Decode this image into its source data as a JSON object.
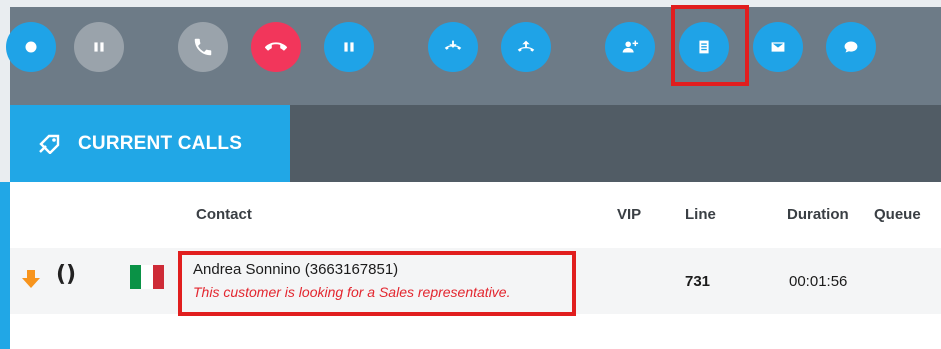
{
  "toolbar": {
    "buttons": [
      {
        "icon": "record-icon",
        "color": "#1fa3e7"
      },
      {
        "icon": "hold-icon",
        "color": "#9aa3ab"
      },
      {
        "icon": "phone-icon",
        "color": "#9aa3ab"
      },
      {
        "icon": "hangup-icon",
        "color": "#f2365b"
      },
      {
        "icon": "pause-icon",
        "color": "#1fa3e7"
      },
      {
        "icon": "transfer-in-icon",
        "color": "#1fa3e7"
      },
      {
        "icon": "transfer-out-icon",
        "color": "#1fa3e7"
      },
      {
        "icon": "add-contact-icon",
        "color": "#1fa3e7"
      },
      {
        "icon": "notes-icon",
        "color": "#1fa3e7"
      },
      {
        "icon": "email-icon",
        "color": "#1fa3e7"
      },
      {
        "icon": "chat-icon",
        "color": "#1fa3e7"
      }
    ]
  },
  "tab": {
    "label": "CURRENT CALLS",
    "icon": "call-tab-icon"
  },
  "table": {
    "headers": {
      "contact": "Contact",
      "vip": "VIP",
      "line": "Line",
      "duration": "Duration",
      "queue": "Queue"
    },
    "row": {
      "direction_icon": "incoming-arrow-icon",
      "status_icon": "brackets-icon",
      "country_flag": "italy-flag",
      "contact_name": "Andrea Sonnino (3663167851)",
      "contact_note": "This customer is looking for a Sales representative.",
      "vip": "",
      "line": "731",
      "duration": "00:01:56"
    }
  },
  "colors": {
    "accent": "#21a7e6",
    "toolbar_bg": "#6d7b87",
    "tabbar_bg": "#515c65",
    "highlight": "#e11e1e",
    "note": "#e3262f"
  }
}
